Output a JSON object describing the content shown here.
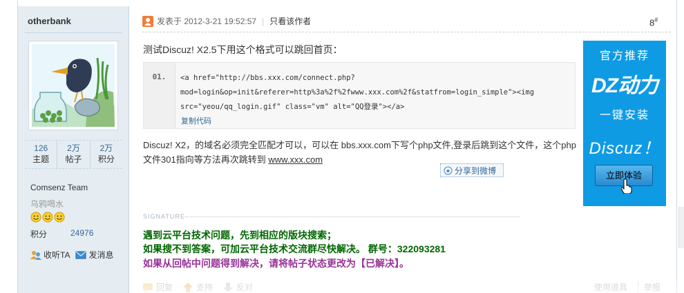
{
  "user": {
    "name": "otherbank",
    "stats": [
      {
        "value": "126",
        "label": "主题"
      },
      {
        "value": "2万",
        "label": "帖子"
      },
      {
        "value": "2万",
        "label": "积分"
      }
    ],
    "group": "Comsenz Team",
    "rank": "乌鸦喝水",
    "points_label": "积分",
    "points_value": "24976",
    "follow_label": "收听TA",
    "message_label": "发消息"
  },
  "post": {
    "posted_at": "发表于 2012-3-21 19:52:57",
    "only_author": "只看该作者",
    "floor": "8",
    "floor_mark": "#",
    "lead": "测试Discuz! X2.5下用这个格式可以跳回首页：",
    "code": {
      "line_no": "01.",
      "text": "<a href=\"http://bbs.xxx.com/connect.php?mod=login&op=init&referer=http%3a%2f%2fwww.xxx.com%2f&statfrom=login_simple\"><img src=\"yeou/qq_login.gif\" class=\"vm\" alt=\"QQ登录\"></a>",
      "copy_label": "复制代码"
    },
    "para_text": "Discuz! X2，的域名必须完全匹配才可以，可以在 bbs.xxx.com下写个php文件,登录后跳到这个文件，这个php文件301指向等方法再次跳转到 ",
    "para_link": "www.xxx.com",
    "share_label": "分享到微博"
  },
  "ad": {
    "line1": "官方推荐",
    "line2": "DZ动力",
    "line3": "一键安装",
    "line4": "Discuz！",
    "button": "立即体验",
    "bg_color": "#0f9be4"
  },
  "signature": {
    "title": "SIGNATURE",
    "line1": "遇到云平台技术问题，先到相应的版块搜索；",
    "line2": "如果搜不到答案，可加云平台技术交流群尽快解决。  群号：322093281",
    "line3": "如果从回帖中问题得到解决，请将帖子状态更改为【已解决】。"
  },
  "actions": {
    "reply": "回复",
    "support": "支持",
    "oppose": "反对",
    "tools": "使用道具",
    "report": "举报"
  }
}
